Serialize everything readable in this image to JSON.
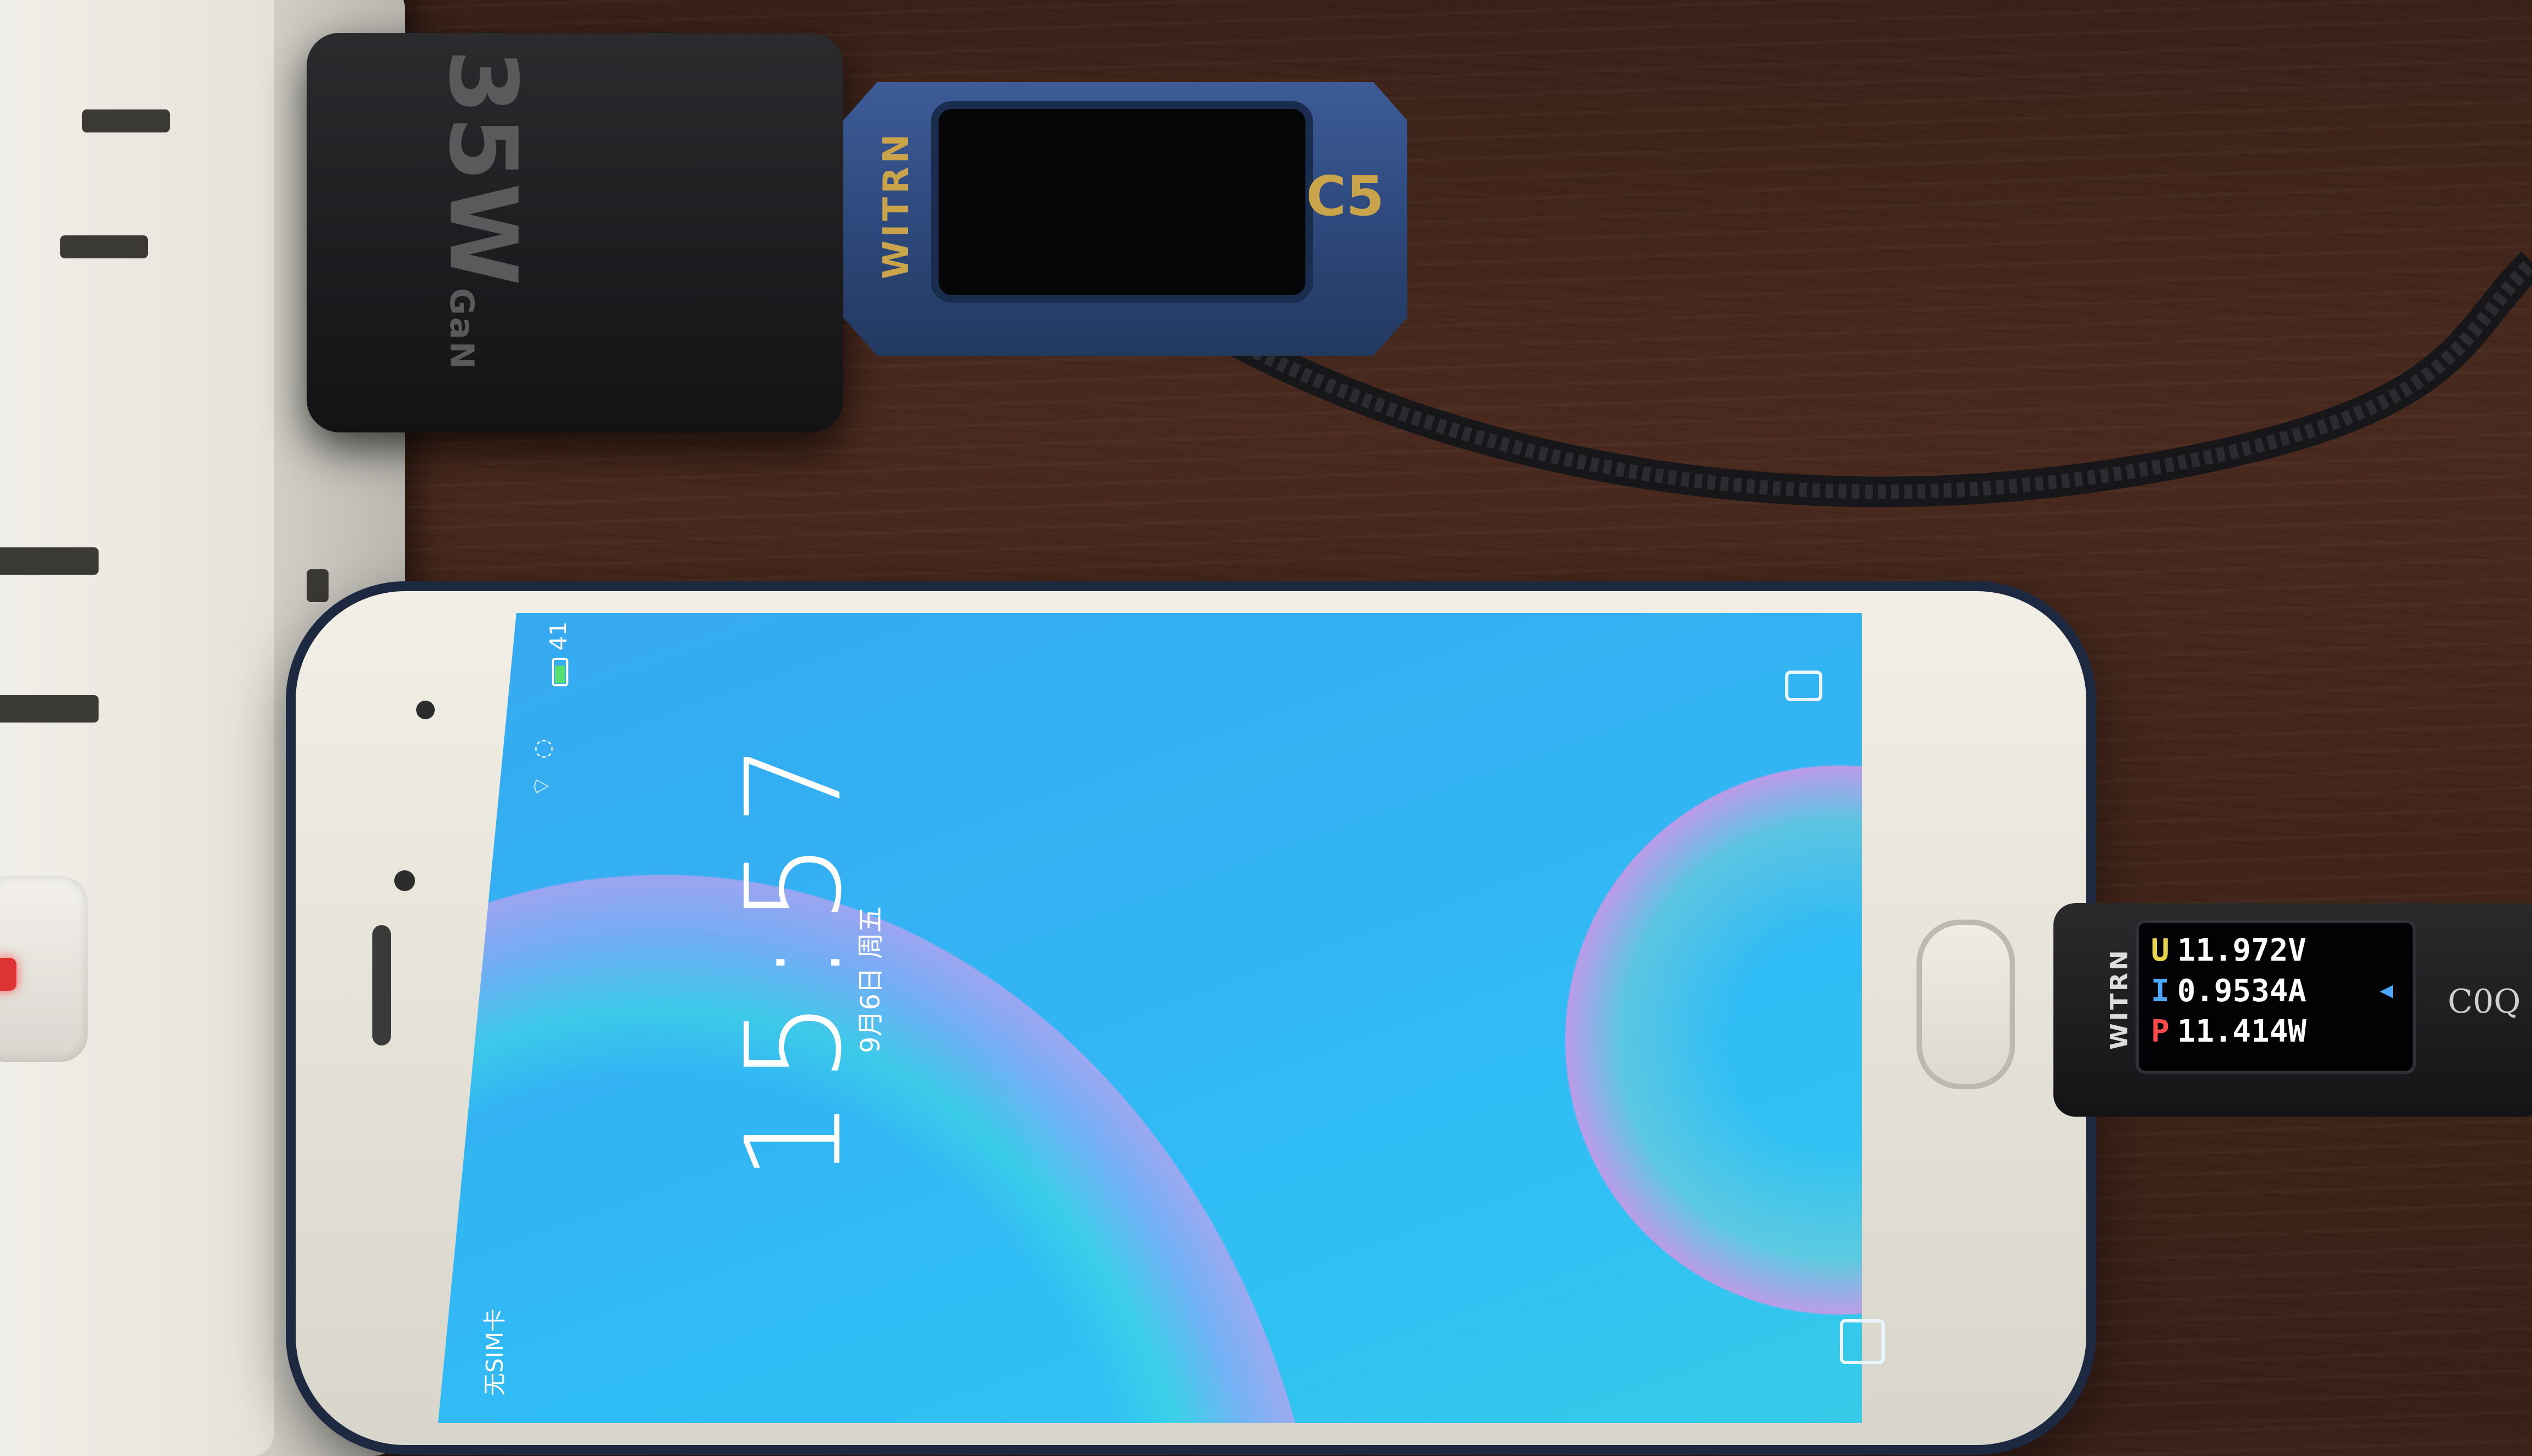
{
  "scene": "photo of a phone charging on a wooden desk with two USB power meters",
  "charger": {
    "label": "35W",
    "label_sub": "GaN"
  },
  "meter_c5": {
    "brand": "WITRN",
    "model": "C5"
  },
  "phone_lockscreen": {
    "status_battery": "41",
    "time": "15:57",
    "date": "9月6日 周五",
    "carrier": "无SIM卡",
    "camera_icon": "camera-icon"
  },
  "meter_c0q": {
    "brand": "WITRN",
    "model": "C0Q",
    "voltage": "11.972V",
    "current": "0.9534A",
    "power": "11.414W",
    "u_label": "U",
    "i_label": "I",
    "p_label": "P",
    "colors": {
      "u": "#e8d44a",
      "i": "#4aa8ff",
      "p": "#ff4a4a"
    }
  }
}
